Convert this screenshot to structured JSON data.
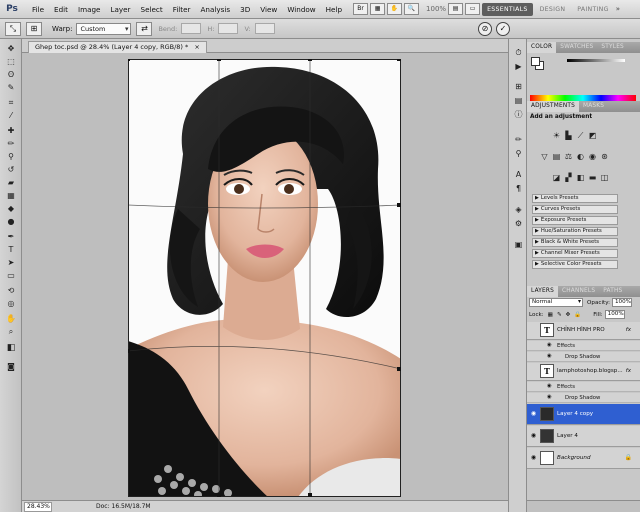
{
  "app": {
    "logo": "Ps"
  },
  "menu": [
    "File",
    "Edit",
    "Image",
    "Layer",
    "Select",
    "Filter",
    "Analysis",
    "3D",
    "View",
    "Window",
    "Help"
  ],
  "menubar_extras": {
    "zoom": "100%"
  },
  "workspaces": [
    "ESSENTIALS",
    "DESIGN",
    "PAINTING",
    "»"
  ],
  "options": {
    "warp_label": "Warp:",
    "warp_value": "Custom",
    "bend_label": "Bend:",
    "h_label": "H:",
    "v_label": "V:"
  },
  "document": {
    "tab_title": "Ghep toc.psd @ 28.4% (Layer 4 copy, RGB/8) *"
  },
  "status": {
    "zoom": "28.43%",
    "doc_size": "Doc: 16.5M/18.7M"
  },
  "colors": {
    "selection": "#2f5fd1",
    "canvas_bg": "#bebebe",
    "panel_bg": "#c8c8c8"
  },
  "panels": {
    "color_tabs": [
      "COLOR",
      "SWATCHES",
      "STYLES"
    ],
    "adjust_tabs": [
      "ADJUSTMENTS",
      "MASKS"
    ],
    "add_adjustment": "Add an adjustment",
    "presets": [
      "Levels Presets",
      "Curves Presets",
      "Exposure Presets",
      "Hue/Saturation Presets",
      "Black & White Presets",
      "Channel Mixer Presets",
      "Selective Color Presets"
    ],
    "layers_tabs": [
      "LAYERS",
      "CHANNELS",
      "PATHS"
    ]
  },
  "layers": {
    "blend_mode": "Normal",
    "opacity_label": "Opacity:",
    "opacity": "100%",
    "lock_label": "Lock:",
    "fill_label": "Fill:",
    "fill": "100%",
    "items": [
      {
        "name": "CHỈNH HÌNH PRO",
        "type": "text",
        "visible": false,
        "fx": "fx",
        "effects": [
          "Effects",
          "Drop Shadow"
        ]
      },
      {
        "name": "lamphotoshop.blogsp...",
        "type": "text",
        "visible": false,
        "fx": "fx",
        "effects": [
          "Effects",
          "Drop Shadow"
        ]
      },
      {
        "name": "Layer 4 copy",
        "type": "image",
        "visible": true,
        "selected": true
      },
      {
        "name": "Layer 4",
        "type": "image",
        "visible": true
      },
      {
        "name": "Background",
        "type": "fill",
        "visible": true
      }
    ]
  }
}
